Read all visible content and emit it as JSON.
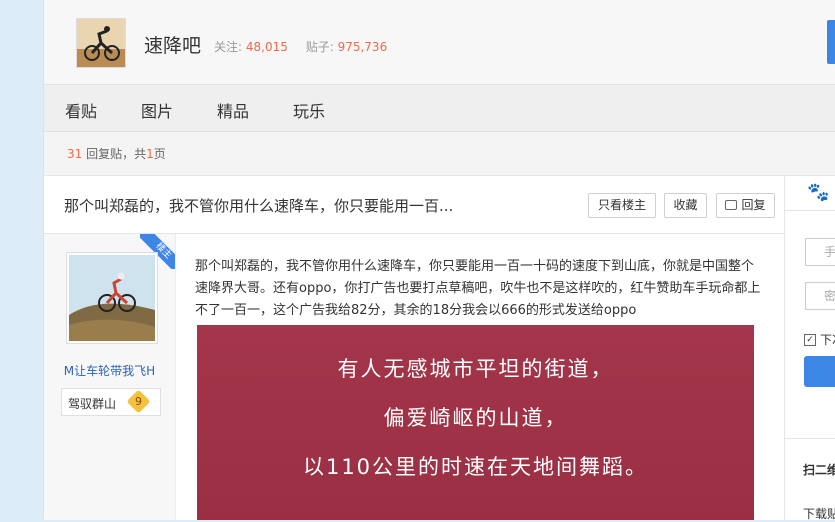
{
  "forum": {
    "name": "速降吧",
    "follow_label": "关注:",
    "follow_count": "48,015",
    "posts_label": "贴子:",
    "posts_count": "975,736"
  },
  "nav": {
    "tabs": [
      "看贴",
      "图片",
      "精品",
      "玩乐"
    ]
  },
  "page_info": {
    "reply_count": "31",
    "reply_text": "回复贴，共",
    "page_count": "1",
    "page_suffix": "页"
  },
  "thread": {
    "title": "那个叫郑磊的，我不管你用什么速降车，你只要能用一百...",
    "buttons": {
      "only_op": "只看楼主",
      "favorite": "收藏",
      "reply": "回复"
    }
  },
  "post": {
    "op_badge": "楼主",
    "author_name": "M让车轮带我飞H",
    "author_badge_label": "驾驭群山",
    "author_level": "9",
    "text": "那个叫郑磊的，我不管你用什么速降车，你只要能用一百一十码的速度下到山底，你就是中国整个速降界大哥。还有oppo，你打广告也要打点草稿吧，吹牛也不是这样吹的，红牛赞助车手玩命都上不了一百一，这个广告我给82分，其余的18分我会以666的形式发送给oppo",
    "image_lines": [
      "有人无感城市平坦的街道，",
      "偏爱崎岖的山道，",
      "以110公里的时速在天地间舞蹈。"
    ]
  },
  "sidebar": {
    "username_placeholder": "手",
    "password_placeholder": "密",
    "checkbox_label": "下次",
    "scan_label": "扫二维",
    "download_label": "下载贴"
  },
  "colors": {
    "accent": "#3c86e6",
    "highlight": "#f06a4b",
    "image_bg": "#a4354a"
  }
}
